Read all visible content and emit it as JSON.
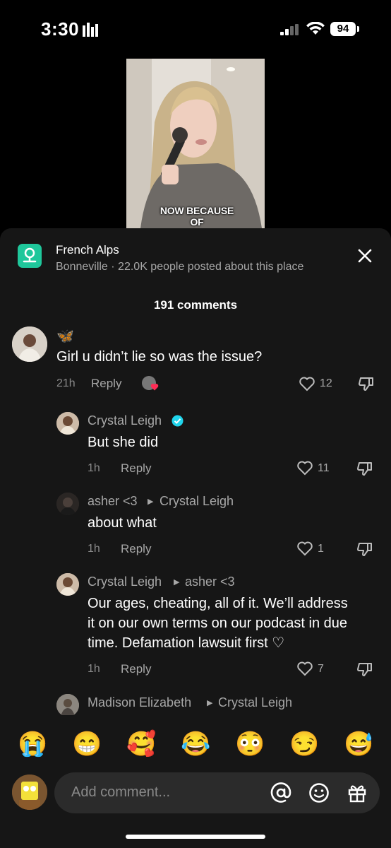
{
  "status": {
    "time": "3:30",
    "battery": "94"
  },
  "video": {
    "caption": "NOW BECAUSE OF"
  },
  "place": {
    "title": "French Alps",
    "subtitle": "Bonneville · 22.0K people posted about this place"
  },
  "comments_header": "191 comments",
  "comments": [
    {
      "username": "🦋",
      "text": "Girl u didn’t lie so was the issue?",
      "time": "21h",
      "reply": "Reply",
      "likes": "12"
    },
    {
      "username": "Crystal Leigh",
      "verified": true,
      "text": "But she did",
      "time": "1h",
      "reply": "Reply",
      "likes": "11"
    },
    {
      "username": "asher <3",
      "reply_to": "Crystal Leigh",
      "text": "about what",
      "time": "1h",
      "reply": "Reply",
      "likes": "1"
    },
    {
      "username": "Crystal Leigh",
      "reply_to": "asher <3",
      "text_lines": [
        "Our ages, cheating, all of it. We’ll address",
        "it on our own terms on our podcast in due",
        "time. Defamation lawsuit first ♡"
      ],
      "time": "1h",
      "reply": "Reply",
      "likes": "7"
    },
    {
      "username": "Madison Elizabeth",
      "reply_to": "Crystal Leigh"
    }
  ],
  "emojis": [
    "😭",
    "😁",
    "🥰",
    "😂",
    "😳",
    "😏",
    "😅"
  ],
  "input": {
    "placeholder": "Add comment..."
  },
  "colors": {
    "sheet": "#161616",
    "accent_place": "#1fc79b",
    "verified": "#20d5ec",
    "heart": "#fe2c55"
  }
}
